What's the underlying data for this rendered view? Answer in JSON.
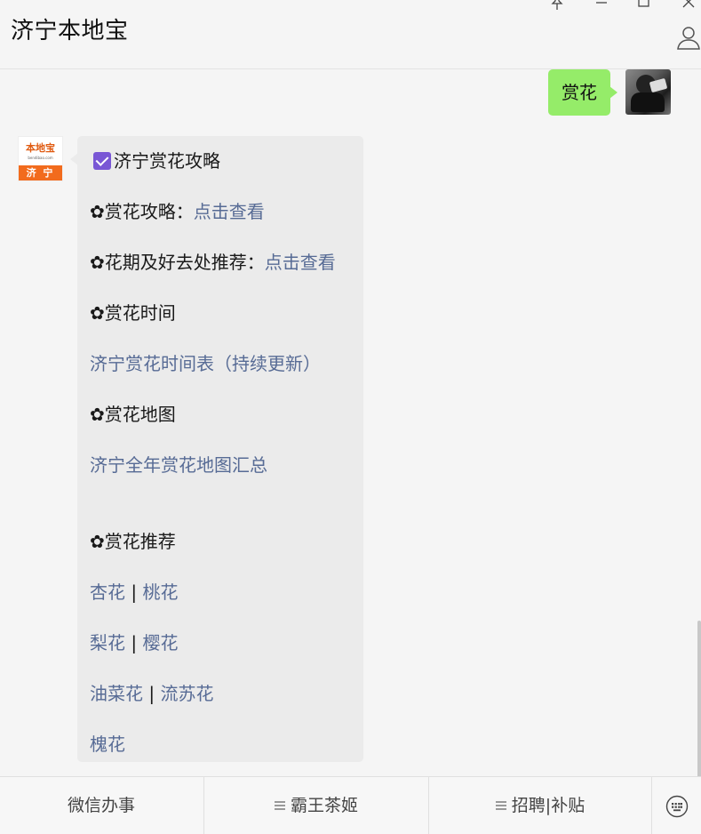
{
  "window": {
    "title": "济宁本地宝"
  },
  "chat": {
    "sent_message": "赏花",
    "official_avatar": {
      "logo_text": "本地宝",
      "logo_subtext": "bendibao.com",
      "city_label": "济 宁"
    },
    "card": {
      "heading": "济宁赏花攻略",
      "lines": [
        {
          "prefix": "✿赏花攻略：",
          "link": "点击查看"
        },
        {
          "prefix": "✿花期及好去处推荐：",
          "link": "点击查看"
        },
        {
          "prefix": "✿赏花时间",
          "link": ""
        },
        {
          "prefix": "",
          "link": "济宁赏花时间表（持续更新）"
        },
        {
          "prefix": "✿赏花地图",
          "link": ""
        },
        {
          "prefix": "",
          "link": "济宁全年赏花地图汇总"
        },
        {
          "prefix": "✿赏花推荐",
          "link": ""
        }
      ],
      "flowers": [
        {
          "a": "杏花",
          "sep": " | ",
          "b": "桃花"
        },
        {
          "a": "梨花",
          "sep": " | ",
          "b": "樱花"
        },
        {
          "a": "油菜花",
          "sep": " | ",
          "b": "流苏花"
        },
        {
          "a": "槐花",
          "sep": "",
          "b": ""
        }
      ]
    }
  },
  "bottom_menu": {
    "items": [
      "微信办事",
      "霸王茶姬",
      "招聘|补贴"
    ],
    "keyboard_icon": "keyboard-icon"
  },
  "colors": {
    "sent_bubble": "#95ec69",
    "link": "#576b95",
    "checkbox": "#7957d5",
    "brand_orange": "#f26b1d"
  }
}
